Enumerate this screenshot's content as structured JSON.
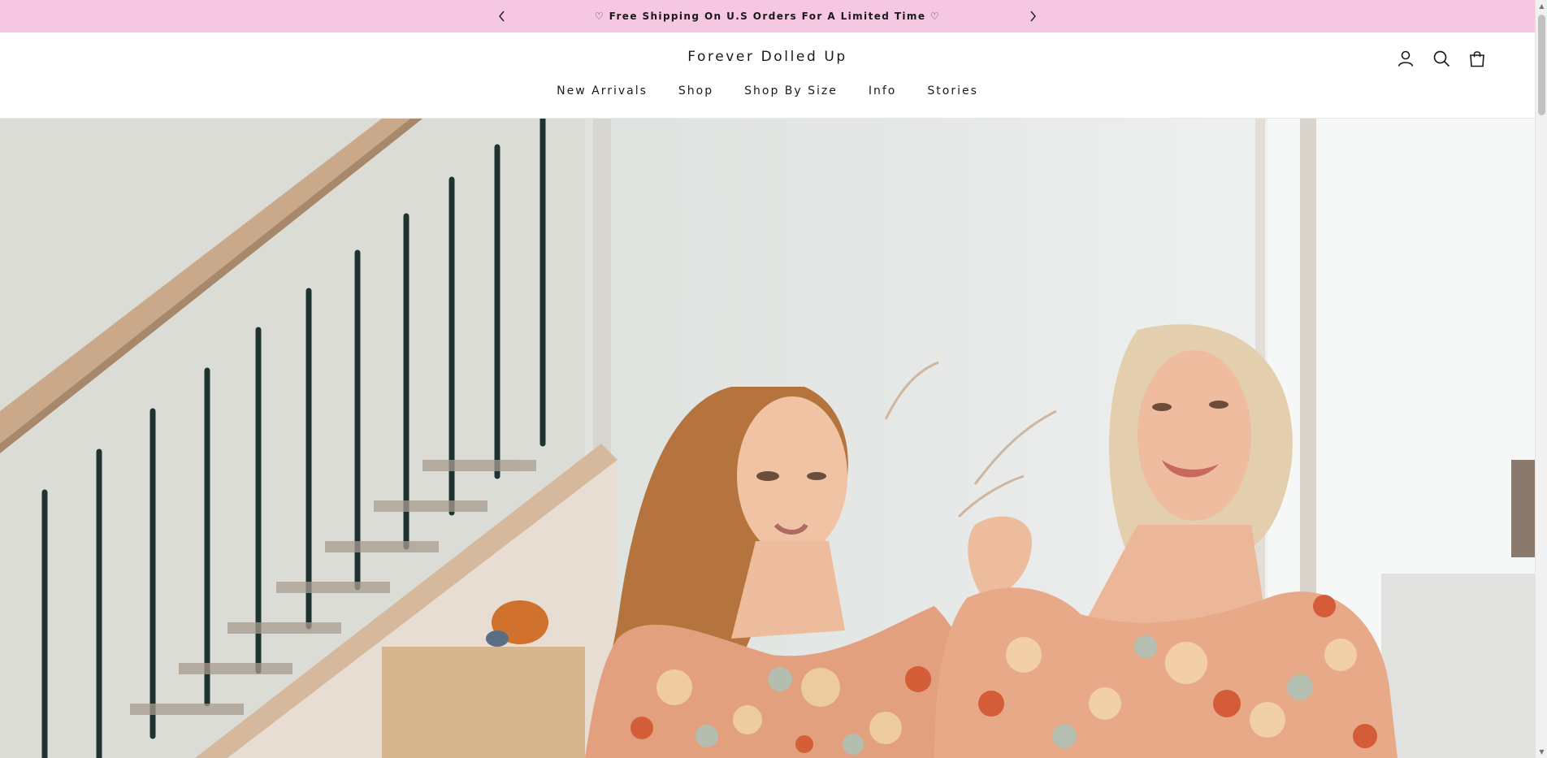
{
  "announcement": {
    "message": "♡ Free Shipping On U.S Orders For A Limited Time ♡",
    "prev_icon": "chevron-left-icon",
    "next_icon": "chevron-right-icon",
    "background": "#f6c7e3"
  },
  "header": {
    "logo": "Forever Dolled Up",
    "icons": [
      "account-icon",
      "search-icon",
      "cart-icon"
    ]
  },
  "nav": {
    "items": [
      {
        "label": "New Arrivals"
      },
      {
        "label": "Shop"
      },
      {
        "label": "Shop By Size"
      },
      {
        "label": "Info"
      },
      {
        "label": "Stories"
      }
    ]
  },
  "hero": {
    "image": "lifestyle-photo-two-women-floral-dresses"
  }
}
